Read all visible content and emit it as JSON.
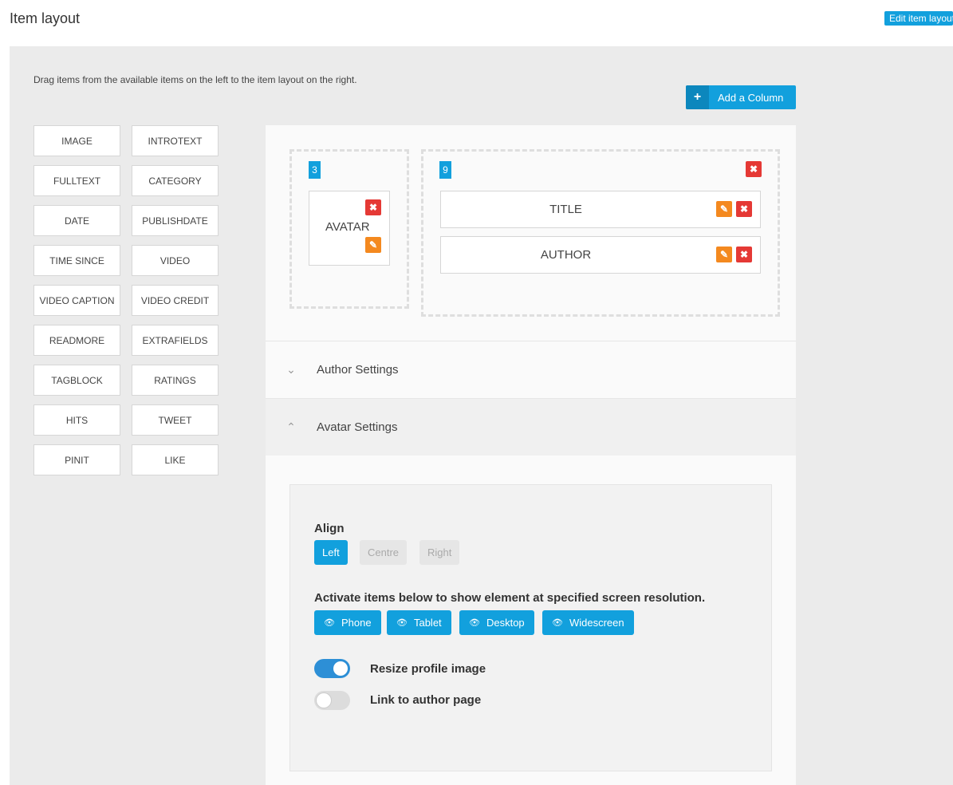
{
  "header": {
    "title": "Item layout",
    "edit_label": "Edit item layout"
  },
  "instructions": "Drag items from the available items on the left to the item layout on the right.",
  "add_column_label": "Add a Column",
  "available_items": [
    "IMAGE",
    "INTROTEXT",
    "FULLTEXT",
    "CATEGORY",
    "DATE",
    "PUBLISHDATE",
    "TIME SINCE",
    "VIDEO",
    "VIDEO CAPTION",
    "VIDEO CREDIT",
    "READMORE",
    "EXTRAFIELDS",
    "TAGBLOCK",
    "RATINGS",
    "HITS",
    "TWEET",
    "PINIT",
    "LIKE"
  ],
  "layout": {
    "columns": [
      {
        "width": "3",
        "items": [
          "AVATAR"
        ]
      },
      {
        "width": "9",
        "items": [
          "TITLE",
          "AUTHOR"
        ]
      }
    ]
  },
  "accordion": {
    "author_settings": "Author Settings",
    "avatar_settings": "Avatar Settings"
  },
  "avatar_settings": {
    "align_label": "Align",
    "align_options": [
      "Left",
      "Centre",
      "Right"
    ],
    "align_selected": "Left",
    "resolution_label": "Activate items below to show element at specified screen resolution.",
    "resolutions": [
      "Phone",
      "Tablet",
      "Desktop",
      "Widescreen"
    ],
    "resize_label": "Resize profile image",
    "resize_on": true,
    "link_label": "Link to author page",
    "link_on": false
  },
  "colors": {
    "accent": "#12a0dd",
    "delete": "#e53935",
    "edit": "#f4891f"
  }
}
